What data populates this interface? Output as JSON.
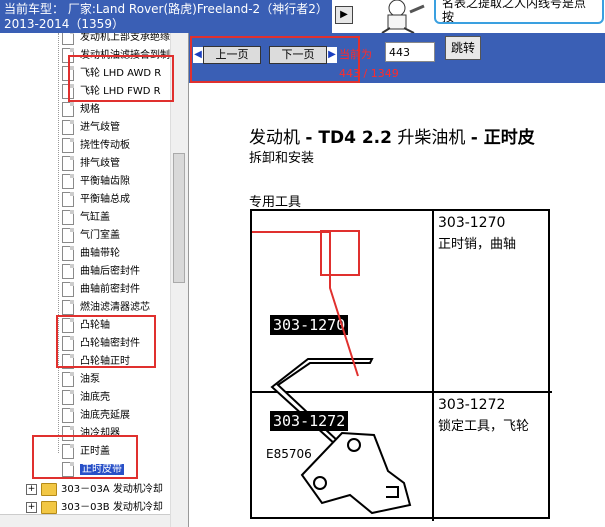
{
  "header": {
    "car_title": "当前车型： 厂家:Land Rover(路虎)Freeland-2（神行者2）2013-2014（1359）",
    "expand_icon": "arrow-right-icon",
    "tip_text": "名表之提取之人内线号是点按"
  },
  "tree": {
    "items": [
      {
        "label": "发动机上部支承绝缘"
      },
      {
        "label": "发动机油滤接合到制"
      },
      {
        "label": "飞轮 LHD AWD R"
      },
      {
        "label": "飞轮 LHD FWD R"
      },
      {
        "label": "规格"
      },
      {
        "label": "进气歧管"
      },
      {
        "label": "挠性传动板"
      },
      {
        "label": "排气歧管"
      },
      {
        "label": "平衡轴齿隙"
      },
      {
        "label": "平衡轴总成"
      },
      {
        "label": "气缸盖"
      },
      {
        "label": "气门室盖"
      },
      {
        "label": "曲轴带轮"
      },
      {
        "label": "曲轴后密封件"
      },
      {
        "label": "曲轴前密封件"
      },
      {
        "label": "燃油滤清器滤芯"
      },
      {
        "label": "凸轮轴"
      },
      {
        "label": "凸轮轴密封件"
      },
      {
        "label": "凸轮轴正时"
      },
      {
        "label": "油泵"
      },
      {
        "label": "油底壳"
      },
      {
        "label": "油底壳延展"
      },
      {
        "label": "油冷却器"
      },
      {
        "label": "正时盖"
      },
      {
        "label": "正时皮带"
      }
    ],
    "folders": [
      {
        "label": "303－03A 发动机冷却"
      },
      {
        "label": "303－03B 发动机冷却"
      }
    ]
  },
  "nav": {
    "prev_label": "上一页",
    "next_label": "下一页",
    "current_label": "当前为",
    "page_value": "443",
    "go_label": "跳转",
    "page_count": "443 / 1349"
  },
  "doc": {
    "title_prefix": "发动机 ",
    "title_bold": "- TD4 2.2",
    "title_mid": " 升柴油机 ",
    "title_tail": "- 正时皮",
    "subtitle": "拆卸和安装",
    "tools_heading": "专用工具",
    "tools": [
      {
        "label": "303-1270",
        "part_no": "303-1270",
        "desc": "正时销，曲轴",
        "fig": "E85706"
      },
      {
        "label": "303-1272",
        "part_no": "303-1272",
        "desc": "锁定工具，飞轮"
      }
    ]
  }
}
